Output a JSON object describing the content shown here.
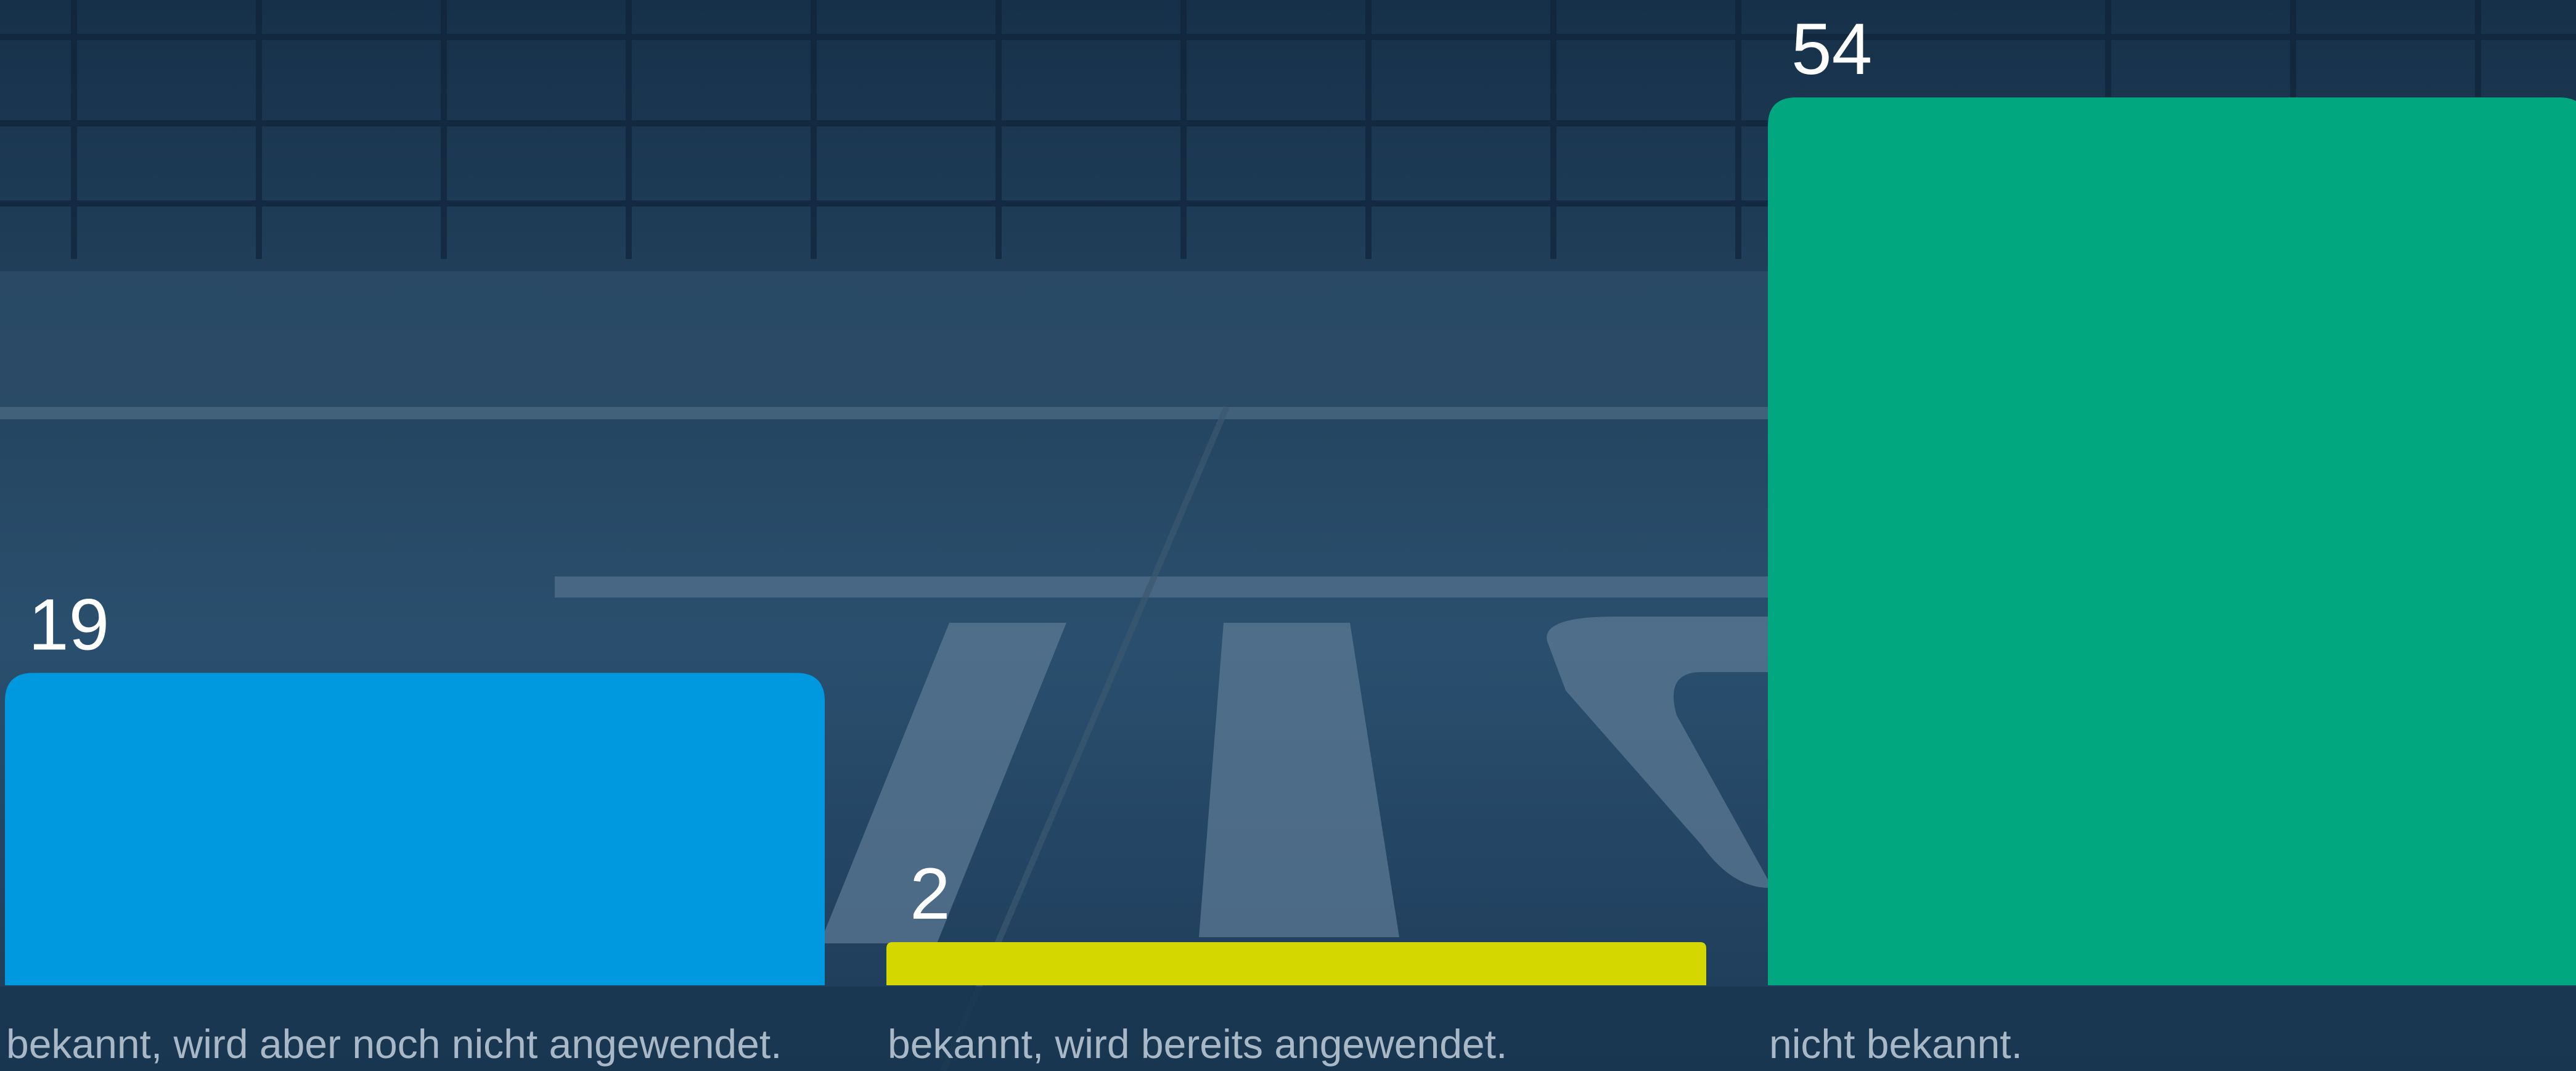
{
  "chart_data": {
    "type": "bar",
    "categories": [
      "bekannt, wird aber noch nicht angewendet.",
      "bekannt, wird bereits angewendet.",
      "nicht bekannt."
    ],
    "values": [
      19,
      2,
      54
    ],
    "ylim": [
      0,
      54
    ],
    "grid": false,
    "legend": "none",
    "colors": [
      "#0099e0",
      "#d4d800",
      "#00a77f"
    ],
    "label_color": "#ffffff",
    "category_label_color": "#a9b8c6",
    "background": "photo of a rainy plaza in front of a glass office building, dark blue overlay"
  }
}
